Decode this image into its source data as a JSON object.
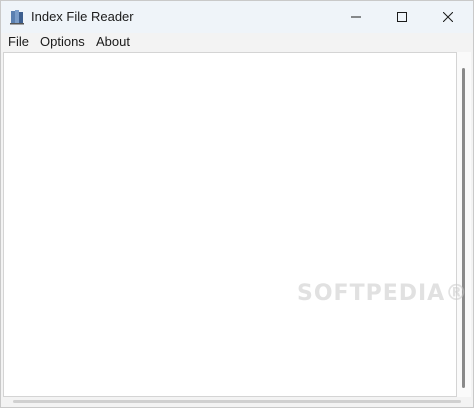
{
  "window": {
    "title": "Index File Reader",
    "icon": "book-app-icon"
  },
  "menu": {
    "items": [
      "File",
      "Options",
      "About"
    ]
  },
  "content": {
    "watermark": "SOFTPEDIA®"
  },
  "colors": {
    "titlebar_bg": "#eff4f9",
    "content_bg": "#ffffff"
  }
}
